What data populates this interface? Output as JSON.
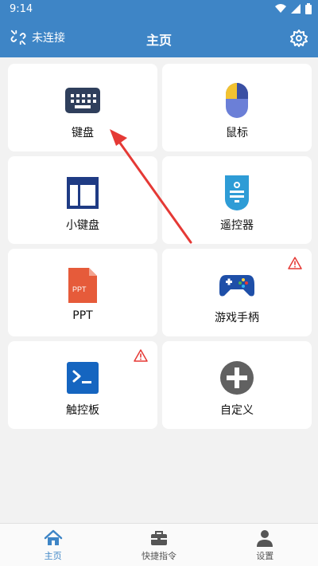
{
  "status": {
    "time": "9:14"
  },
  "appbar": {
    "connection": "未连接",
    "title": "主页"
  },
  "cards": [
    {
      "label": "键盘",
      "icon": "keyboard-icon"
    },
    {
      "label": "鼠标",
      "icon": "mouse-icon"
    },
    {
      "label": "小键盘",
      "icon": "numpad-icon"
    },
    {
      "label": "遥控器",
      "icon": "remote-icon"
    },
    {
      "label": "PPT",
      "icon": "ppt-icon",
      "icon_text": "PPT"
    },
    {
      "label": "游戏手柄",
      "icon": "gamepad-icon",
      "warning": true
    },
    {
      "label": "触控板",
      "icon": "touchpad-icon",
      "warning": true
    },
    {
      "label": "自定义",
      "icon": "add-icon"
    }
  ],
  "nav": [
    {
      "label": "主页",
      "active": true
    },
    {
      "label": "快捷指令",
      "active": false
    },
    {
      "label": "设置",
      "active": false
    }
  ],
  "colors": {
    "primary": "#3e85c6",
    "keyboard": "#2f3f5c",
    "numpad": "#1f3b84",
    "remote": "#2e9cd6",
    "ppt": "#e65b3a",
    "touchpad": "#1565c0",
    "warning": "#e53935"
  }
}
